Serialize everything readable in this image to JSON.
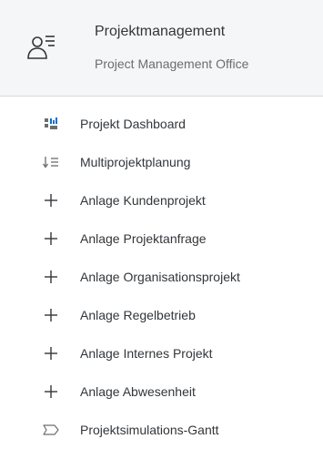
{
  "header": {
    "title": "Projektmanagement",
    "subtitle": "Project Management Office",
    "icon": "user-list-icon"
  },
  "menu": {
    "items": [
      {
        "label": "Projekt Dashboard",
        "icon": "dashboard-icon"
      },
      {
        "label": "Multiprojektplanung",
        "icon": "sort-descending-icon"
      },
      {
        "label": "Anlage Kundenprojekt",
        "icon": "add-icon"
      },
      {
        "label": "Anlage Projektanfrage",
        "icon": "add-icon"
      },
      {
        "label": "Anlage Organisationsprojekt",
        "icon": "add-icon"
      },
      {
        "label": "Anlage Regelbetrieb",
        "icon": "add-icon"
      },
      {
        "label": "Anlage Internes Projekt",
        "icon": "add-icon"
      },
      {
        "label": "Anlage Abwesenheit",
        "icon": "add-icon"
      },
      {
        "label": "Projektsimulations-Gantt",
        "icon": "process-icon"
      }
    ]
  },
  "colors": {
    "header_bg": "#f5f6f7",
    "text": "#32363a",
    "subtext": "#6a6d70",
    "icon": "#6a6d70"
  }
}
